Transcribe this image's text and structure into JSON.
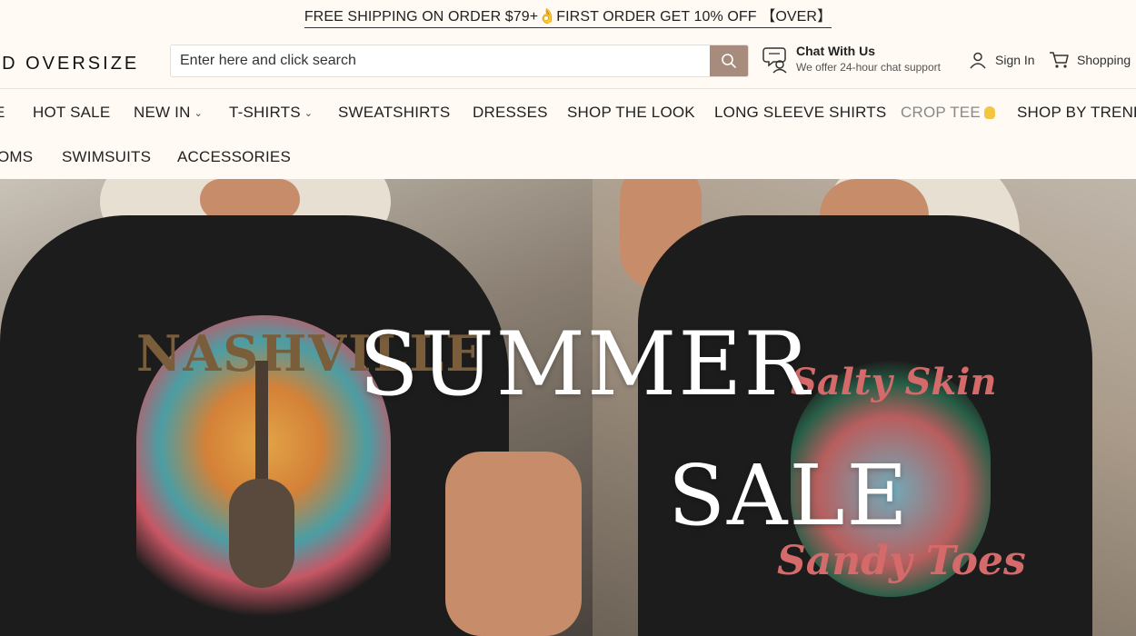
{
  "announcement": {
    "text": "FREE SHIPPING ON ORDER $79+👌FIRST ORDER GET 10% OFF 【OVER】"
  },
  "header": {
    "logo": "LD OVERSIZE",
    "search_placeholder": "Enter here and click search",
    "chat_title": "Chat With Us",
    "chat_subtitle": "We offer 24-hour chat support",
    "signin_label": "Sign In",
    "shopping_label": "Shopping",
    "accent_color": "#a78b7d"
  },
  "nav": {
    "row1": [
      {
        "label": "E"
      },
      {
        "label": "HOT SALE"
      },
      {
        "label": "NEW IN"
      },
      {
        "label": "T-SHIRTS"
      },
      {
        "label": "SWEATSHIRTS"
      },
      {
        "label": "DRESSES"
      },
      {
        "label": "SHOP THE LOOK"
      },
      {
        "label": "LONG SLEEVE SHIRTS"
      },
      {
        "label": "CROP TEE"
      },
      {
        "label": "SHOP BY TREND"
      }
    ],
    "row2": [
      {
        "label": "OMS"
      },
      {
        "label": "SWIMSUITS"
      },
      {
        "label": "ACCESSORIES"
      }
    ]
  },
  "hero": {
    "headline_line1": "SUMMER",
    "headline_line2": "SALE",
    "left_graphic_text": "NASHVILLE",
    "right_graphic_text1": "Salty Skin",
    "right_graphic_text2": "Sandy Toes"
  }
}
